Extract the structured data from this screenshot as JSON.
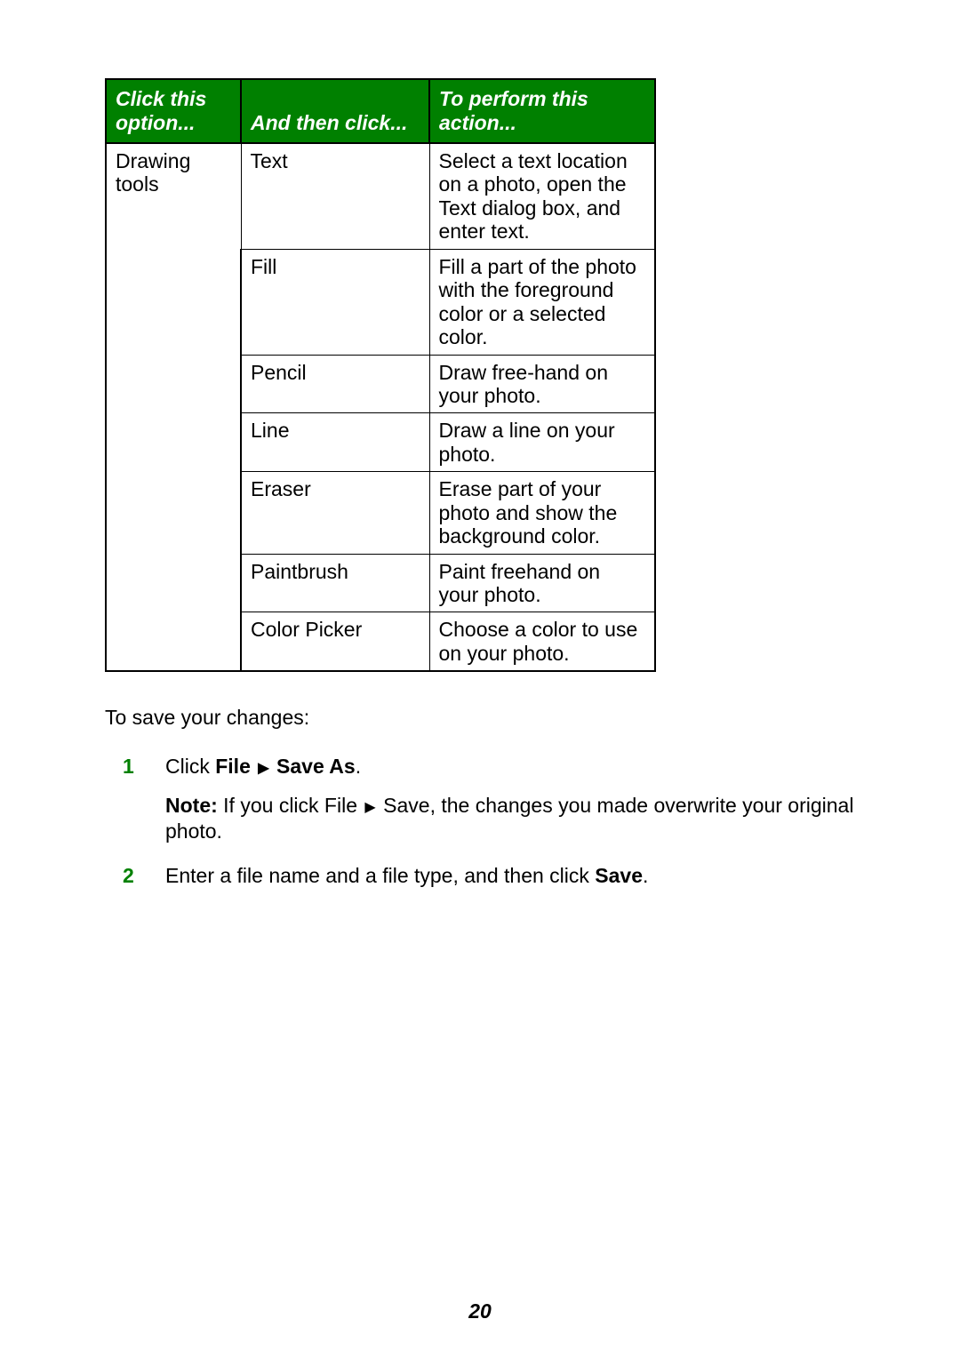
{
  "table": {
    "headers": {
      "col1": "Click this option...",
      "col2": "And then click...",
      "col3": "To perform this action..."
    },
    "group_label": "Drawing tools",
    "rows": [
      {
        "click": "Text",
        "action": "Select a text location on a photo, open the Text dialog box, and enter text."
      },
      {
        "click": "Fill",
        "action": "Fill a part of the photo with the foreground color or a selected color."
      },
      {
        "click": "Pencil",
        "action": "Draw free-hand on your photo."
      },
      {
        "click": "Line",
        "action": "Draw a line on your photo."
      },
      {
        "click": "Eraser",
        "action": "Erase part of your photo and show the background color."
      },
      {
        "click": "Paintbrush",
        "action": "Paint freehand on your photo."
      },
      {
        "click": "Color Picker",
        "action": "Choose a color to use on your photo."
      }
    ]
  },
  "save_intro": "To save your changes:",
  "steps": {
    "s1": {
      "num": "1",
      "prefix": "Click ",
      "bold1": "File",
      "bold2": "Save As",
      "suffix": "."
    },
    "note": {
      "label": "Note:",
      "before": " If you click File ",
      "after": " Save, the changes you made overwrite your original photo."
    },
    "s2": {
      "num": "2",
      "before": "Enter a file name and a file type, and then click ",
      "bold": "Save",
      "after": "."
    }
  },
  "arrow": "▶",
  "page_number": "20"
}
